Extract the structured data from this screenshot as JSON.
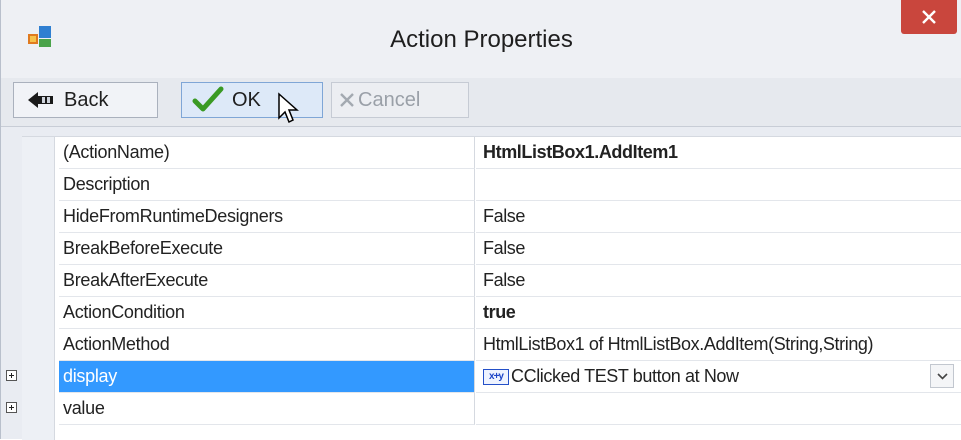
{
  "window": {
    "title": "Action Properties",
    "accent": "#c9463d"
  },
  "toolbar": {
    "back_label": "Back",
    "ok_label": "OK",
    "cancel_label": "Cancel"
  },
  "properties": {
    "rows": [
      {
        "name": "(ActionName)",
        "value": "HtmlListBox1.AddItem1"
      },
      {
        "name": "Description",
        "value": ""
      },
      {
        "name": "HideFromRuntimeDesigners",
        "value": "False"
      },
      {
        "name": "BreakBeforeExecute",
        "value": "False"
      },
      {
        "name": "BreakAfterExecute",
        "value": "False"
      },
      {
        "name": "ActionCondition",
        "value": "true"
      },
      {
        "name": "ActionMethod",
        "value": "HtmlListBox1 of HtmlListBox.AddItem(String,String)"
      },
      {
        "name": "display",
        "value": "CClicked TEST button at Now",
        "icon_text": "x+y"
      },
      {
        "name": "value",
        "value": ""
      }
    ],
    "selected_color": "#3399ff"
  }
}
